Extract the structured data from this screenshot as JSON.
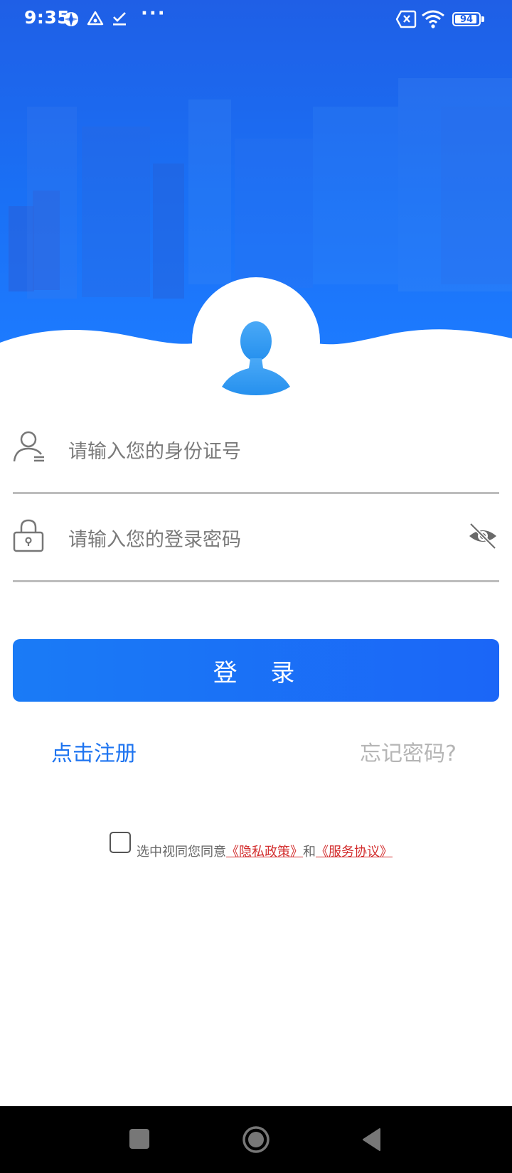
{
  "status_bar": {
    "time": "9:35",
    "battery": "94",
    "battery_level": 0.94,
    "icons": [
      "vpn-icon",
      "warning-triangle-icon",
      "check-download-icon",
      "more-dots-icon",
      "no-sim-icon",
      "wifi-icon",
      "battery-icon"
    ]
  },
  "form": {
    "id_placeholder": "请输入您的身份证号",
    "password_placeholder": "请输入您的登录密码",
    "login_label": "登 录"
  },
  "links": {
    "register": "点击注册",
    "forgot": "忘记密码?"
  },
  "agreement": {
    "prefix": "选中视同您同意",
    "privacy": "《隐私政策》",
    "and": "和",
    "terms": "《服务协议》"
  },
  "colors": {
    "primary": "#1B6EF5",
    "link_register": "#1E74F0",
    "link_forgot": "#B5B5B5",
    "agreement_link": "#D32F2F"
  }
}
